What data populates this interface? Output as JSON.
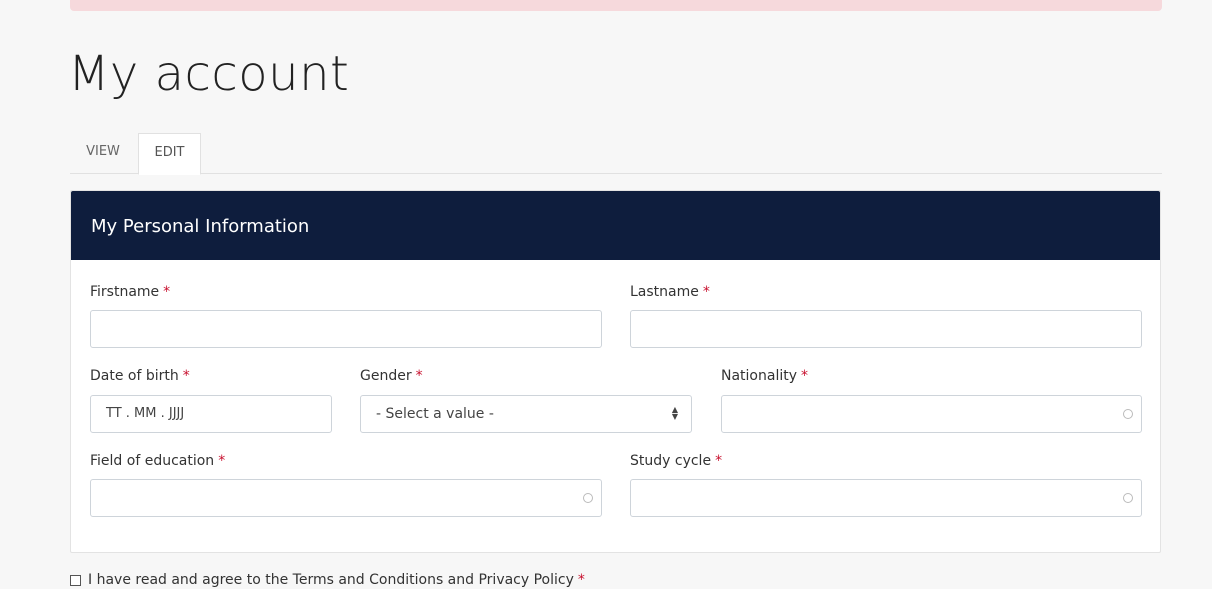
{
  "page": {
    "title": "My account"
  },
  "tabs": [
    {
      "label": "VIEW",
      "active": false
    },
    {
      "label": "EDIT",
      "active": true
    }
  ],
  "section": {
    "title": "My Personal Information"
  },
  "fields": {
    "firstname": {
      "label": "Firstname",
      "required_mark": "*",
      "value": ""
    },
    "lastname": {
      "label": "Lastname",
      "required_mark": "*",
      "value": ""
    },
    "dob": {
      "label": "Date of birth",
      "required_mark": "*",
      "placeholder": "TT . MM . JJJJ"
    },
    "gender": {
      "label": "Gender",
      "required_mark": "*",
      "selected": "- Select a value -"
    },
    "nationality": {
      "label": "Nationality",
      "required_mark": "*",
      "value": ""
    },
    "field_of_education": {
      "label": "Field of education",
      "required_mark": "*",
      "value": ""
    },
    "study_cycle": {
      "label": "Study cycle",
      "required_mark": "*",
      "value": ""
    }
  },
  "terms": {
    "label": "I have read and agree to the Terms and Conditions and Privacy Policy",
    "required_mark": "*",
    "checked": false
  },
  "colors": {
    "header_bg": "#0e1d3d",
    "required": "#c8102e",
    "alert_strip": "#f6d9dc"
  },
  "icons": {
    "autocomplete": "autocomplete-circle-icon",
    "select": "select-updown-arrows-icon"
  }
}
